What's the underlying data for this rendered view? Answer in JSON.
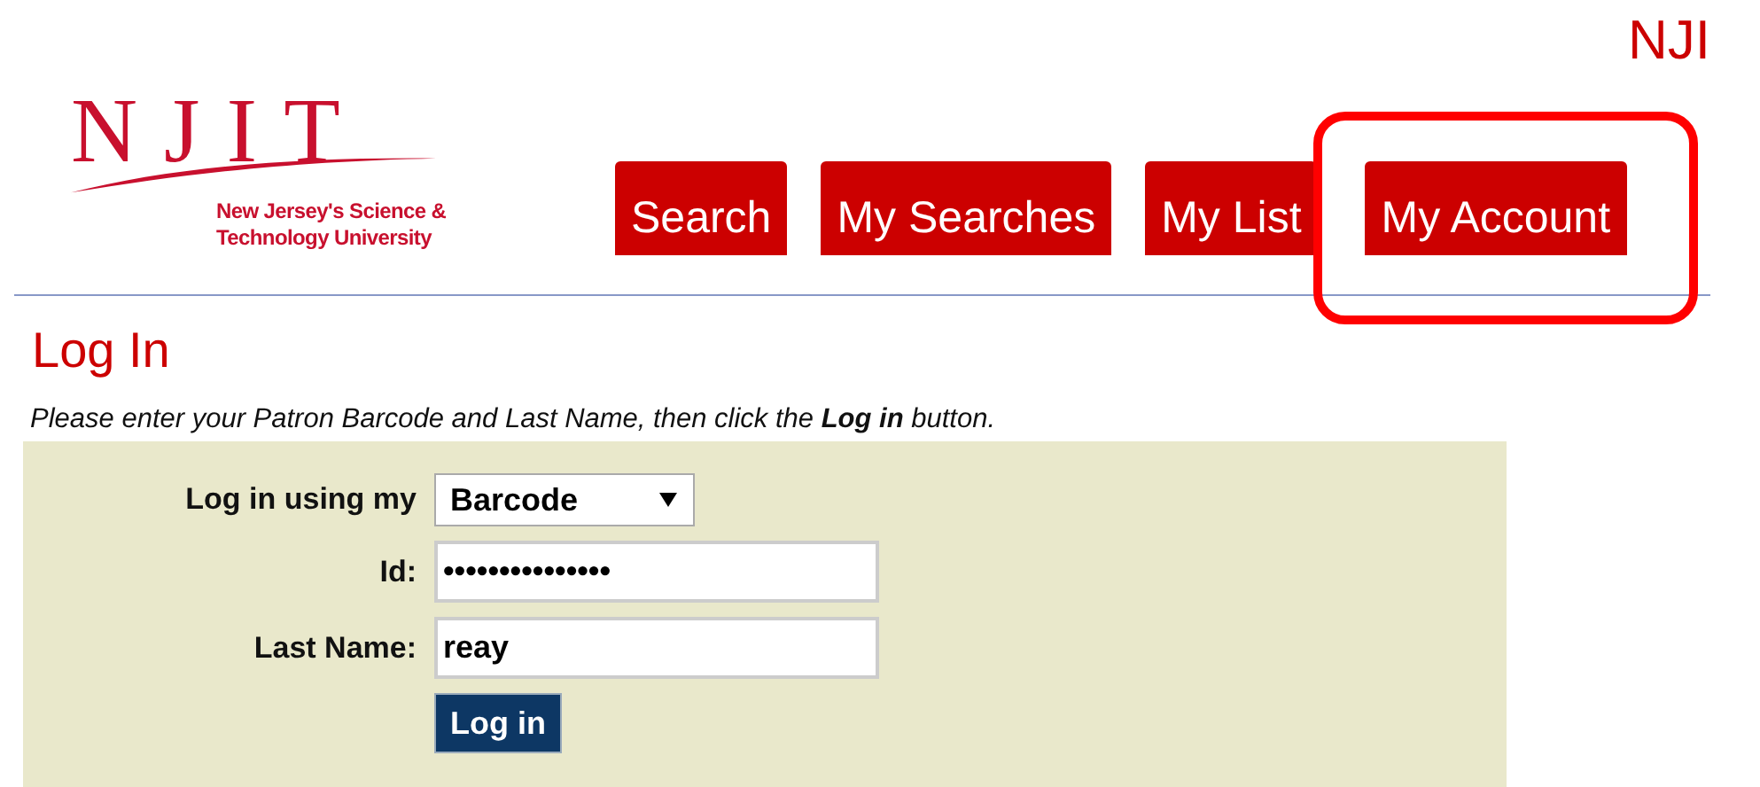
{
  "corner_text": "NJI",
  "logo": {
    "letters": "NJIT",
    "tagline_1": "New Jersey's Science &",
    "tagline_2": "Technology University"
  },
  "tabs": [
    {
      "label": "Search",
      "selected": false,
      "highlighted": false
    },
    {
      "label": "My Searches",
      "selected": false,
      "highlighted": false
    },
    {
      "label": "My List",
      "selected": false,
      "highlighted": false
    },
    {
      "label": "My Account",
      "selected": false,
      "highlighted": true
    }
  ],
  "heading": "Log In",
  "instructions": "Please enter your Patron Barcode and Last Name, then click the **Log in** button.",
  "form": {
    "method_label": "Log in using my",
    "method_value": "Barcode",
    "id_label": "Id:",
    "id_value": "•••••••••••••••",
    "last_name_label": "Last Name:",
    "last_name_value": "reay",
    "submit": "Log in"
  }
}
